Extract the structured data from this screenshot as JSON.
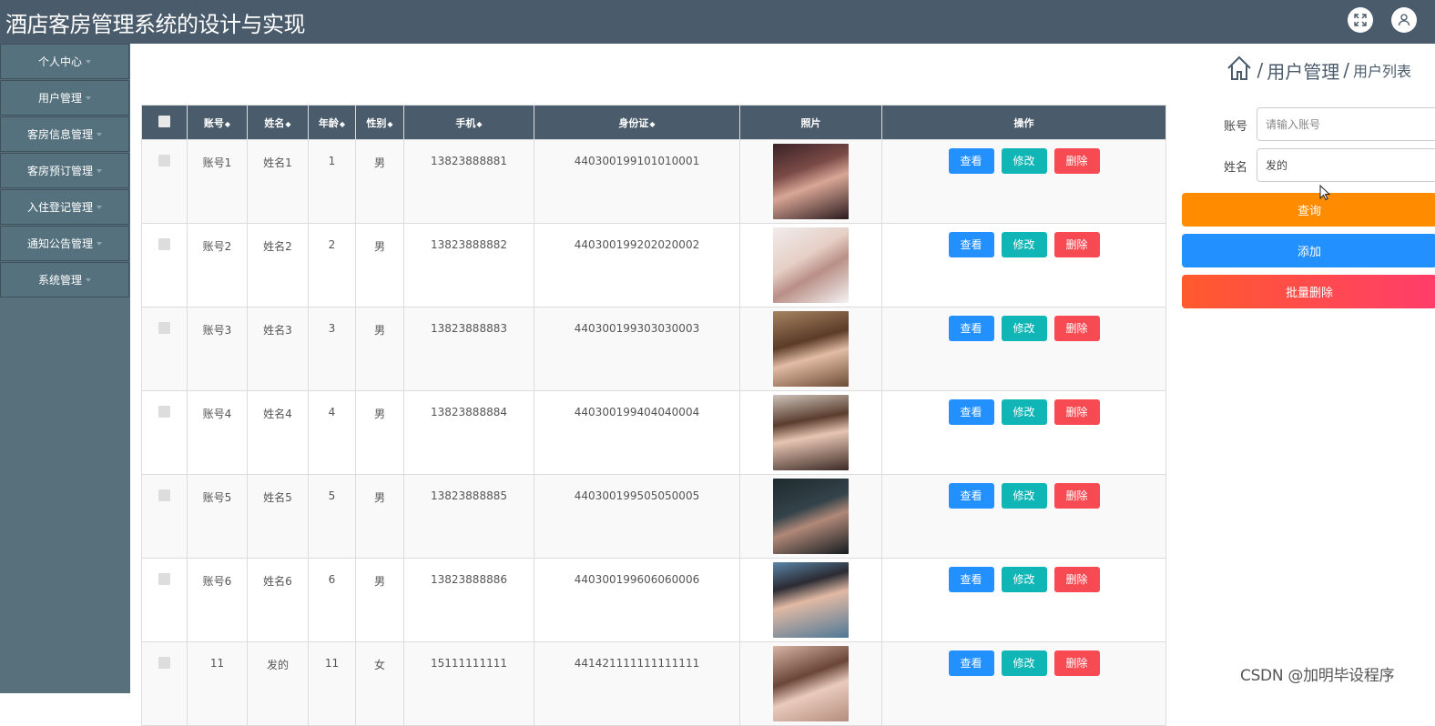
{
  "app": {
    "title": "酒店客房管理系统的设计与实现"
  },
  "header": {
    "icons": [
      "fullscreen-icon",
      "user-icon"
    ]
  },
  "sidebar": {
    "items": [
      {
        "label": "个人中心"
      },
      {
        "label": "用户管理"
      },
      {
        "label": "客房信息管理"
      },
      {
        "label": "客房预订管理"
      },
      {
        "label": "入住登记管理"
      },
      {
        "label": "通知公告管理"
      },
      {
        "label": "系统管理"
      }
    ]
  },
  "breadcrumb": {
    "separator": "/",
    "section": "用户管理",
    "page": "用户列表"
  },
  "table": {
    "sort_marker": "◆",
    "columns": [
      "账号",
      "姓名",
      "年龄",
      "性别",
      "手机",
      "身份证",
      "照片",
      "操作"
    ],
    "actions": {
      "view": "查看",
      "edit": "修改",
      "delete": "删除"
    },
    "rows": [
      {
        "account": "账号1",
        "name": "姓名1",
        "age": "1",
        "gender": "男",
        "phone": "13823888881",
        "id_card": "440300199101010001"
      },
      {
        "account": "账号2",
        "name": "姓名2",
        "age": "2",
        "gender": "男",
        "phone": "13823888882",
        "id_card": "440300199202020002"
      },
      {
        "account": "账号3",
        "name": "姓名3",
        "age": "3",
        "gender": "男",
        "phone": "13823888883",
        "id_card": "440300199303030003"
      },
      {
        "account": "账号4",
        "name": "姓名4",
        "age": "4",
        "gender": "男",
        "phone": "13823888884",
        "id_card": "440300199404040004"
      },
      {
        "account": "账号5",
        "name": "姓名5",
        "age": "5",
        "gender": "男",
        "phone": "13823888885",
        "id_card": "440300199505050005"
      },
      {
        "account": "账号6",
        "name": "姓名6",
        "age": "6",
        "gender": "男",
        "phone": "13823888886",
        "id_card": "440300199606060006"
      },
      {
        "account": "11",
        "name": "发的",
        "age": "11",
        "gender": "女",
        "phone": "15111111111",
        "id_card": "441421111111111111"
      }
    ]
  },
  "search": {
    "account_label": "账号",
    "account_placeholder": "请输入账号",
    "account_value": "",
    "name_label": "姓名",
    "name_value": "发的",
    "query_button": "查询",
    "add_button": "添加",
    "batch_delete_button": "批量删除"
  },
  "watermark": "CSDN @加明毕设程序",
  "colors": {
    "topbar": "#4a5b6b",
    "sidebar": "#58707c",
    "view": "#2390ff",
    "edit": "#10b5b5",
    "delete": "#f74a52",
    "query": "#ff8c00",
    "add": "#2390ff",
    "batch_delete_start": "#ff5a2d",
    "batch_delete_end": "#ff3d6b"
  }
}
